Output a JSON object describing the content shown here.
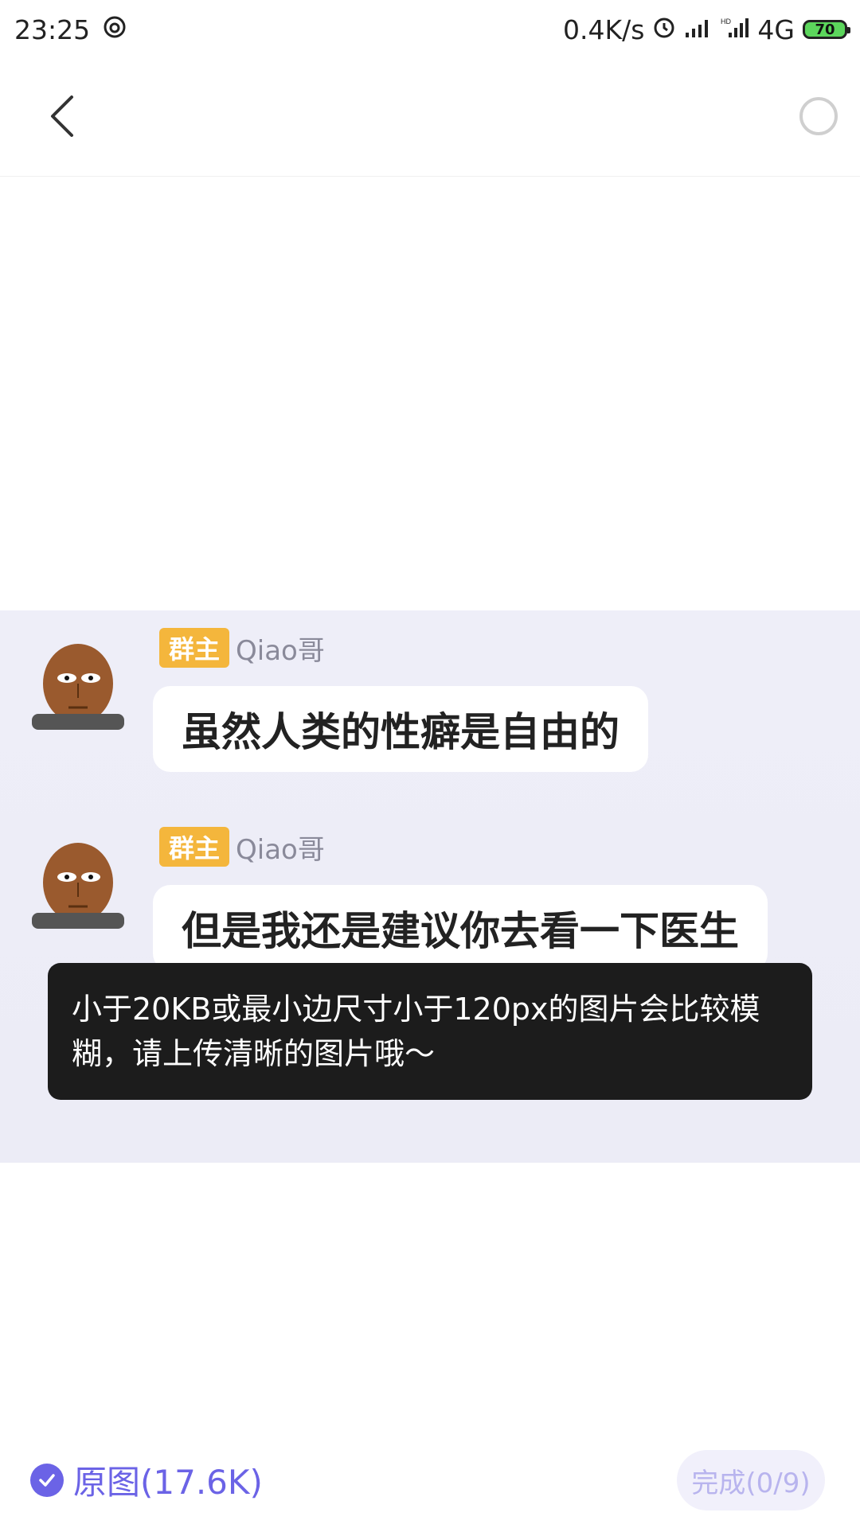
{
  "status_bar": {
    "time": "23:25",
    "speed": "0.4K/s",
    "network": "4G",
    "battery": "70",
    "icons": [
      "netease-music-icon",
      "alarm-icon",
      "signal-icon",
      "hd-signal-icon",
      "battery-icon"
    ]
  },
  "header": {
    "back_icon": "chevron-left-icon",
    "select_icon": "circle-icon"
  },
  "chat_image": {
    "messages": [
      {
        "badge": "群主",
        "name": "Qiao哥",
        "text": "虽然人类的性癖是自由的"
      },
      {
        "badge": "群主",
        "name": "Qiao哥",
        "text": "但是我还是建议你去看一下医生"
      }
    ]
  },
  "toast": {
    "text": "小于20KB或最小边尺寸小于120px的图片会比较模糊，请上传清晰的图片哦～"
  },
  "bottom_bar": {
    "original_label": "原图(17.6K)",
    "done_label": "完成(0/9)"
  },
  "colors": {
    "accent": "#6b63e6",
    "toast_bg": "#1c1c1c",
    "badge": "#f4b63c"
  }
}
